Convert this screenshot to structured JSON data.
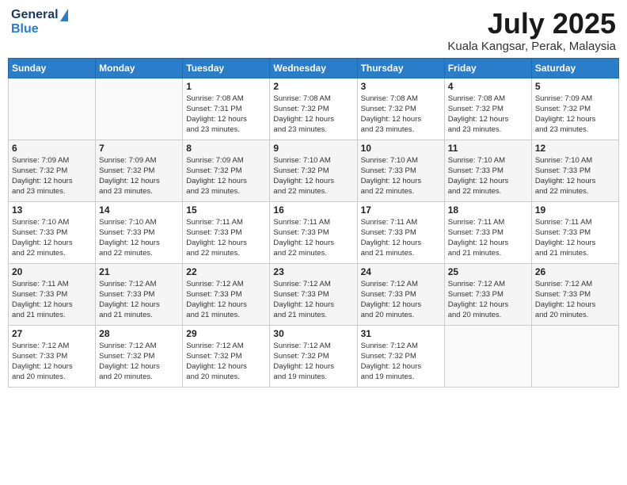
{
  "header": {
    "logo_line1": "General",
    "logo_line2": "Blue",
    "month_title": "July 2025",
    "location": "Kuala Kangsar, Perak, Malaysia"
  },
  "days_of_week": [
    "Sunday",
    "Monday",
    "Tuesday",
    "Wednesday",
    "Thursday",
    "Friday",
    "Saturday"
  ],
  "weeks": [
    [
      {
        "day": "",
        "info": ""
      },
      {
        "day": "",
        "info": ""
      },
      {
        "day": "1",
        "info": "Sunrise: 7:08 AM\nSunset: 7:31 PM\nDaylight: 12 hours\nand 23 minutes."
      },
      {
        "day": "2",
        "info": "Sunrise: 7:08 AM\nSunset: 7:32 PM\nDaylight: 12 hours\nand 23 minutes."
      },
      {
        "day": "3",
        "info": "Sunrise: 7:08 AM\nSunset: 7:32 PM\nDaylight: 12 hours\nand 23 minutes."
      },
      {
        "day": "4",
        "info": "Sunrise: 7:08 AM\nSunset: 7:32 PM\nDaylight: 12 hours\nand 23 minutes."
      },
      {
        "day": "5",
        "info": "Sunrise: 7:09 AM\nSunset: 7:32 PM\nDaylight: 12 hours\nand 23 minutes."
      }
    ],
    [
      {
        "day": "6",
        "info": "Sunrise: 7:09 AM\nSunset: 7:32 PM\nDaylight: 12 hours\nand 23 minutes."
      },
      {
        "day": "7",
        "info": "Sunrise: 7:09 AM\nSunset: 7:32 PM\nDaylight: 12 hours\nand 23 minutes."
      },
      {
        "day": "8",
        "info": "Sunrise: 7:09 AM\nSunset: 7:32 PM\nDaylight: 12 hours\nand 23 minutes."
      },
      {
        "day": "9",
        "info": "Sunrise: 7:10 AM\nSunset: 7:32 PM\nDaylight: 12 hours\nand 22 minutes."
      },
      {
        "day": "10",
        "info": "Sunrise: 7:10 AM\nSunset: 7:33 PM\nDaylight: 12 hours\nand 22 minutes."
      },
      {
        "day": "11",
        "info": "Sunrise: 7:10 AM\nSunset: 7:33 PM\nDaylight: 12 hours\nand 22 minutes."
      },
      {
        "day": "12",
        "info": "Sunrise: 7:10 AM\nSunset: 7:33 PM\nDaylight: 12 hours\nand 22 minutes."
      }
    ],
    [
      {
        "day": "13",
        "info": "Sunrise: 7:10 AM\nSunset: 7:33 PM\nDaylight: 12 hours\nand 22 minutes."
      },
      {
        "day": "14",
        "info": "Sunrise: 7:10 AM\nSunset: 7:33 PM\nDaylight: 12 hours\nand 22 minutes."
      },
      {
        "day": "15",
        "info": "Sunrise: 7:11 AM\nSunset: 7:33 PM\nDaylight: 12 hours\nand 22 minutes."
      },
      {
        "day": "16",
        "info": "Sunrise: 7:11 AM\nSunset: 7:33 PM\nDaylight: 12 hours\nand 22 minutes."
      },
      {
        "day": "17",
        "info": "Sunrise: 7:11 AM\nSunset: 7:33 PM\nDaylight: 12 hours\nand 21 minutes."
      },
      {
        "day": "18",
        "info": "Sunrise: 7:11 AM\nSunset: 7:33 PM\nDaylight: 12 hours\nand 21 minutes."
      },
      {
        "day": "19",
        "info": "Sunrise: 7:11 AM\nSunset: 7:33 PM\nDaylight: 12 hours\nand 21 minutes."
      }
    ],
    [
      {
        "day": "20",
        "info": "Sunrise: 7:11 AM\nSunset: 7:33 PM\nDaylight: 12 hours\nand 21 minutes."
      },
      {
        "day": "21",
        "info": "Sunrise: 7:12 AM\nSunset: 7:33 PM\nDaylight: 12 hours\nand 21 minutes."
      },
      {
        "day": "22",
        "info": "Sunrise: 7:12 AM\nSunset: 7:33 PM\nDaylight: 12 hours\nand 21 minutes."
      },
      {
        "day": "23",
        "info": "Sunrise: 7:12 AM\nSunset: 7:33 PM\nDaylight: 12 hours\nand 21 minutes."
      },
      {
        "day": "24",
        "info": "Sunrise: 7:12 AM\nSunset: 7:33 PM\nDaylight: 12 hours\nand 20 minutes."
      },
      {
        "day": "25",
        "info": "Sunrise: 7:12 AM\nSunset: 7:33 PM\nDaylight: 12 hours\nand 20 minutes."
      },
      {
        "day": "26",
        "info": "Sunrise: 7:12 AM\nSunset: 7:33 PM\nDaylight: 12 hours\nand 20 minutes."
      }
    ],
    [
      {
        "day": "27",
        "info": "Sunrise: 7:12 AM\nSunset: 7:33 PM\nDaylight: 12 hours\nand 20 minutes."
      },
      {
        "day": "28",
        "info": "Sunrise: 7:12 AM\nSunset: 7:32 PM\nDaylight: 12 hours\nand 20 minutes."
      },
      {
        "day": "29",
        "info": "Sunrise: 7:12 AM\nSunset: 7:32 PM\nDaylight: 12 hours\nand 20 minutes."
      },
      {
        "day": "30",
        "info": "Sunrise: 7:12 AM\nSunset: 7:32 PM\nDaylight: 12 hours\nand 19 minutes."
      },
      {
        "day": "31",
        "info": "Sunrise: 7:12 AM\nSunset: 7:32 PM\nDaylight: 12 hours\nand 19 minutes."
      },
      {
        "day": "",
        "info": ""
      },
      {
        "day": "",
        "info": ""
      }
    ]
  ]
}
